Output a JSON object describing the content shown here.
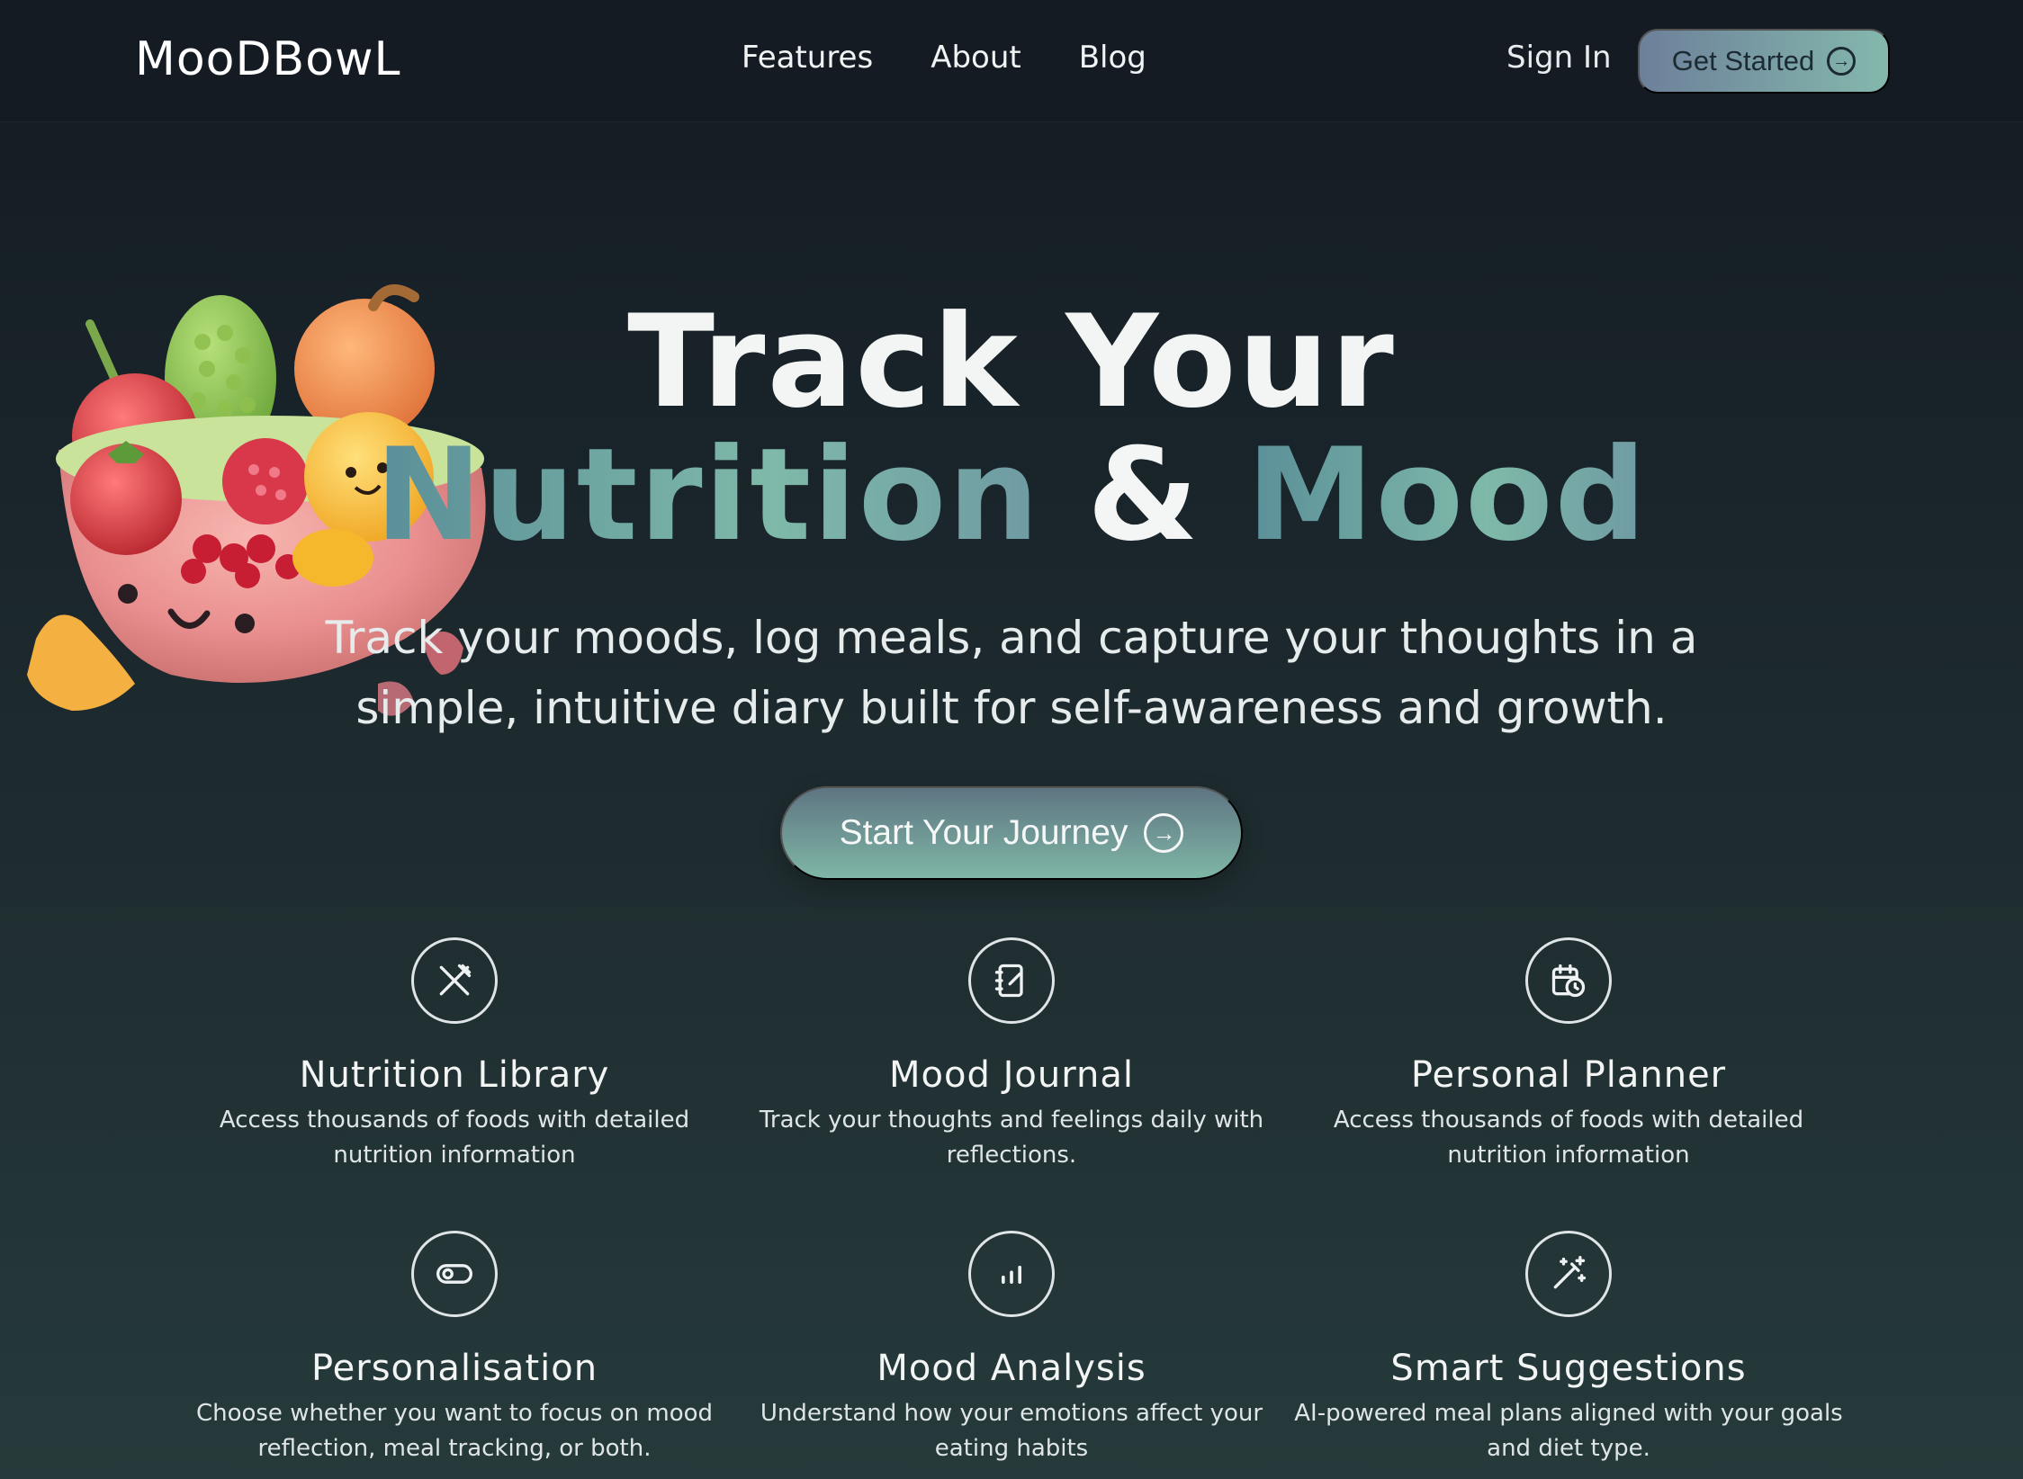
{
  "brand": {
    "logo": "MooDBowL"
  },
  "nav": {
    "links": [
      "Features",
      "About",
      "Blog"
    ],
    "sign_in": "Sign In",
    "get_started": "Get Started"
  },
  "hero": {
    "title_line1": "Track Your",
    "title_word1": "Nutrition",
    "title_amp": "&",
    "title_word2": "Mood",
    "subtitle": "Track your moods, log meals, and capture your thoughts in a simple, intuitive diary built for self-awareness and growth.",
    "cta": "Start Your Journey"
  },
  "features": [
    {
      "title": "Nutrition Library",
      "desc": "Access thousands of foods with detailed nutrition information",
      "icon": "utensils-icon"
    },
    {
      "title": "Mood Journal",
      "desc": "Track your thoughts and feelings daily with reflections.",
      "icon": "notebook-pen-icon"
    },
    {
      "title": "Personal Planner",
      "desc": "Access thousands of foods with detailed nutrition information",
      "icon": "calendar-clock-icon"
    },
    {
      "title": "Personalisation",
      "desc": "Choose whether you want to focus on mood reflection, meal tracking, or both.",
      "icon": "toggle-icon"
    },
    {
      "title": "Mood Analysis",
      "desc": "Understand how your emotions affect your eating habits",
      "icon": "bar-chart-icon"
    },
    {
      "title": "Smart Suggestions",
      "desc": "AI-powered meal plans aligned with your goals and diet type.",
      "icon": "magic-wand-icon"
    }
  ],
  "colors": {
    "accent_teal": "#7fb6a6",
    "accent_slate": "#6d809a",
    "nav_bg": "#141b22"
  }
}
